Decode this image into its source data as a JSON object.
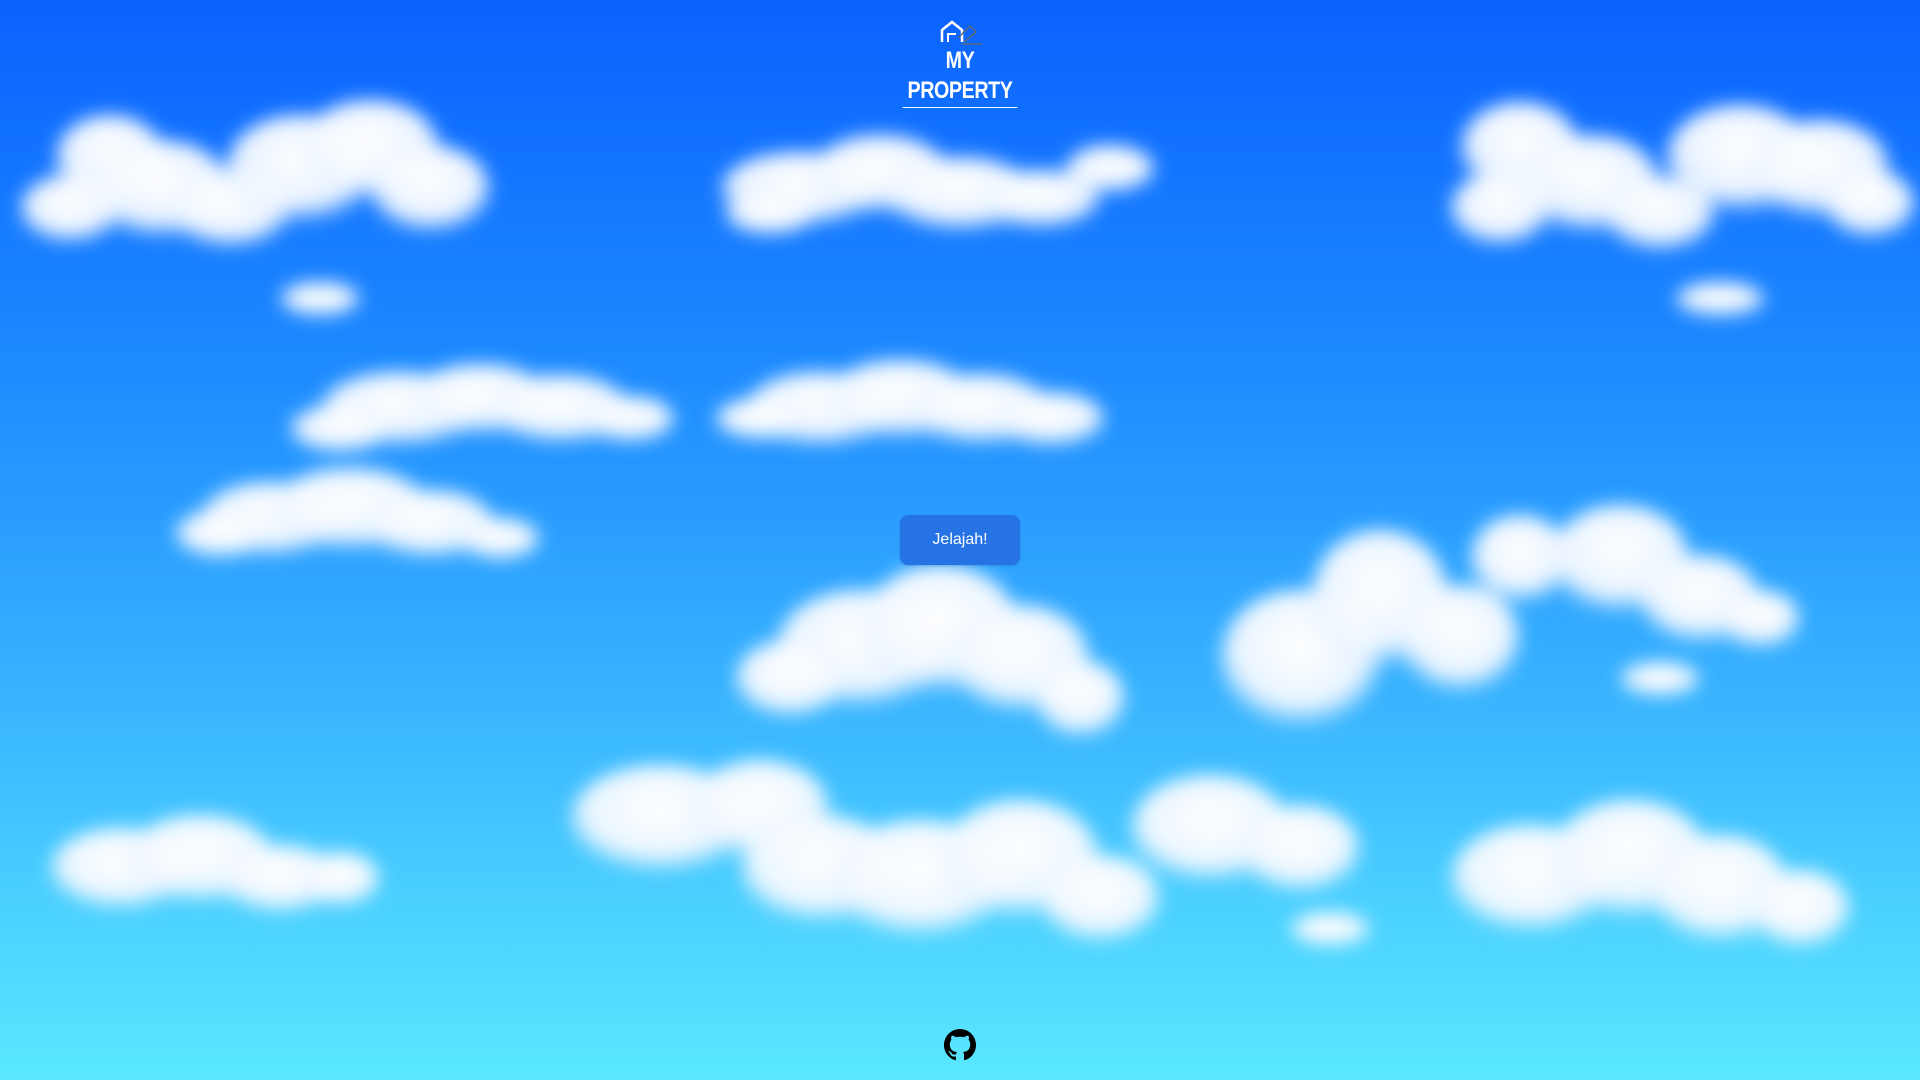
{
  "header": {
    "logo_text": "MY PROPERTY",
    "logo_icon": "house-icon"
  },
  "main": {
    "explore_button_label": "Jelajah!"
  },
  "footer": {
    "github_icon": "github-icon"
  },
  "colors": {
    "sky_top": "#0a62ff",
    "sky_bottom": "#5ae8ff",
    "button_bg": "#2673e6",
    "text": "#ffffff"
  }
}
